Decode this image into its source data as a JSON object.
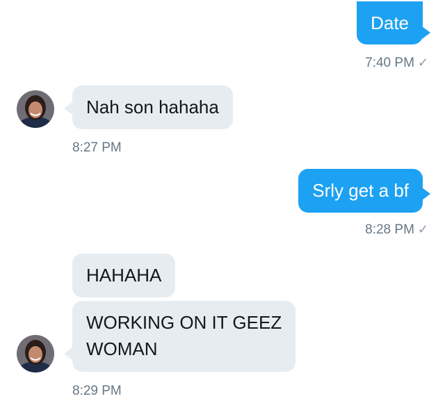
{
  "conversation": {
    "messages": [
      {
        "id": "m1",
        "direction": "outgoing",
        "text": "Date",
        "time": "7:40 PM",
        "read": true
      },
      {
        "id": "m2",
        "direction": "incoming",
        "text": "Nah son hahaha",
        "time": "8:27 PM"
      },
      {
        "id": "m3",
        "direction": "outgoing",
        "text": "Srly get a bf",
        "time": "8:28 PM",
        "read": true
      },
      {
        "id": "m4",
        "direction": "incoming",
        "text": "HAHAHA"
      },
      {
        "id": "m5",
        "direction": "incoming",
        "text_line1": "WORKING ON IT GEEZ",
        "text_line2": "WOMAN",
        "time": "8:29 PM"
      }
    ],
    "check_glyph": "✓"
  },
  "colors": {
    "outgoing_bubble": "#1da1f2",
    "incoming_bubble": "#e6ecf0",
    "timestamp": "#657786"
  },
  "icons": {
    "avatar": "contact-avatar",
    "read_receipt": "checkmark-icon"
  }
}
